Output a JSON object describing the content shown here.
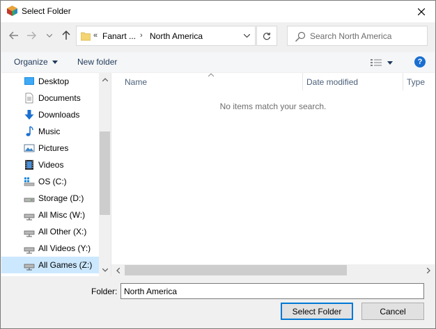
{
  "window": {
    "title": "Select Folder"
  },
  "address": {
    "overflow": "«",
    "crumbs": [
      "Fanart ...",
      "North America"
    ],
    "separator": "›"
  },
  "search": {
    "placeholder": "Search North America",
    "value": ""
  },
  "toolbar": {
    "organize_label": "Organize",
    "new_folder_label": "New folder",
    "help_label": "?"
  },
  "sidebar": {
    "items": [
      {
        "label": "Desktop",
        "icon": "desktop-icon"
      },
      {
        "label": "Documents",
        "icon": "documents-icon"
      },
      {
        "label": "Downloads",
        "icon": "downloads-icon"
      },
      {
        "label": "Music",
        "icon": "music-icon"
      },
      {
        "label": "Pictures",
        "icon": "pictures-icon"
      },
      {
        "label": "Videos",
        "icon": "videos-icon"
      },
      {
        "label": "OS (C:)",
        "icon": "windows-drive-icon"
      },
      {
        "label": "Storage (D:)",
        "icon": "drive-icon"
      },
      {
        "label": "All Misc (W:)",
        "icon": "network-drive-icon"
      },
      {
        "label": "All Other (X:)",
        "icon": "network-drive-icon"
      },
      {
        "label": "All Videos (Y:)",
        "icon": "network-drive-icon"
      },
      {
        "label": "All Games (Z:)",
        "icon": "network-drive-icon",
        "selected": true
      }
    ]
  },
  "content": {
    "columns": [
      "Name",
      "Date modified",
      "Type"
    ],
    "empty_message": "No items match your search."
  },
  "footer": {
    "folder_label": "Folder:",
    "folder_value": "North America",
    "select_label": "Select Folder",
    "cancel_label": "Cancel"
  },
  "colors": {
    "accent": "#0078d7",
    "selected_bg": "#cce8ff",
    "link_text": "#1e395b",
    "help_icon": "#1a6fd1"
  }
}
